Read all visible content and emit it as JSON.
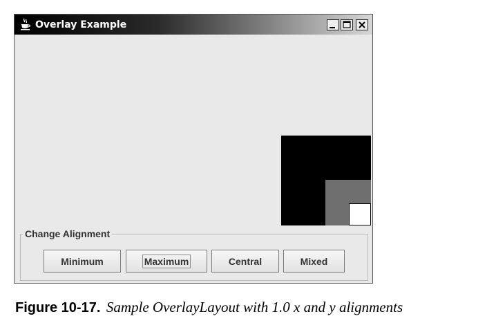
{
  "window": {
    "title": "Overlay Example",
    "title_icon": "java-cup-icon",
    "controls": [
      "minimize-icon",
      "maximize-icon",
      "close-icon"
    ]
  },
  "overlay": {
    "boxes": [
      {
        "name": "large",
        "color": "#000000"
      },
      {
        "name": "medium",
        "color": "#6f6f6f"
      },
      {
        "name": "small",
        "color": "#ffffff"
      }
    ]
  },
  "alignment_group": {
    "title": "Change Alignment",
    "buttons": [
      {
        "label": "Minimum"
      },
      {
        "label": "Maximum",
        "focused": true
      },
      {
        "label": "Central"
      },
      {
        "label": "Mixed"
      }
    ]
  },
  "caption": {
    "label": "Figure 10-17.",
    "text": "Sample OverlayLayout with 1.0 x and y alignments"
  }
}
